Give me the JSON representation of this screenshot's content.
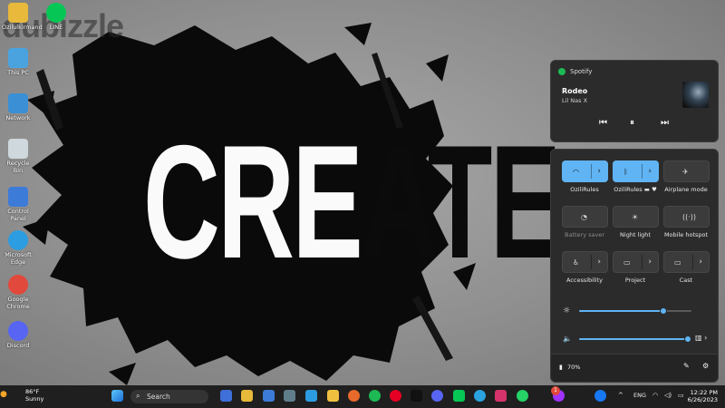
{
  "watermark": "dubizzle",
  "wallpaper_text": {
    "white": "CRE",
    "black": "ATE"
  },
  "desktop_icons": [
    {
      "label": "Ozilulkirmand",
      "icon": "folder-icon",
      "color": "#e8b93a"
    },
    {
      "label": "LINE",
      "icon": "line-app-icon",
      "color": "#06c755"
    },
    {
      "label": "This PC",
      "icon": "monitor-icon",
      "color": "#4aa3df"
    },
    {
      "label": "Network",
      "icon": "network-icon",
      "color": "#3b8fd4"
    },
    {
      "label": "Recycle Bin",
      "icon": "recycle-bin-icon",
      "color": "#cfd8dc"
    },
    {
      "label": "Control Panel",
      "icon": "control-panel-icon",
      "color": "#3d7bd8"
    },
    {
      "label": "Microsoft Edge",
      "icon": "edge-icon",
      "color": "#2b9de0"
    },
    {
      "label": "Google Chrome",
      "icon": "chrome-icon",
      "color": "#e0493b"
    },
    {
      "label": "Discord",
      "icon": "discord-icon",
      "color": "#5865f2"
    }
  ],
  "spotify": {
    "app": "Spotify",
    "track": "Rodeo",
    "artist": "Lil Nas X",
    "prev": "⏮",
    "pause": "⏸",
    "next": "⏭"
  },
  "quick_settings": {
    "tiles": [
      {
        "label": "OziliRules",
        "icon": "wifi-icon",
        "glyph": "◠",
        "on": true,
        "split": true
      },
      {
        "label": "OziliRules ▬ ♥",
        "icon": "bluetooth-icon",
        "glyph": "ᛒ",
        "on": true,
        "split": true
      },
      {
        "label": "Airplane mode",
        "icon": "airplane-icon",
        "glyph": "✈",
        "on": false,
        "split": false
      },
      {
        "label": "Battery saver",
        "icon": "battery-saver-icon",
        "glyph": "◔",
        "on": false,
        "split": false,
        "dim": true
      },
      {
        "label": "Night light",
        "icon": "night-light-icon",
        "glyph": "☀",
        "on": false,
        "split": false
      },
      {
        "label": "Mobile hotspot",
        "icon": "hotspot-icon",
        "glyph": "((·))",
        "on": false,
        "split": false
      },
      {
        "label": "Accessibility",
        "icon": "accessibility-icon",
        "glyph": "♿",
        "on": false,
        "split": true
      },
      {
        "label": "Project",
        "icon": "project-icon",
        "glyph": "▭",
        "on": false,
        "split": true
      },
      {
        "label": "Cast",
        "icon": "cast-icon",
        "glyph": "▭",
        "on": false,
        "split": true
      }
    ],
    "chevron": "›",
    "brightness": 0.75,
    "volume": 0.98,
    "battery": "70%"
  },
  "taskbar": {
    "weather_temp": "86°F",
    "weather_desc": "Sunny",
    "search": "Search",
    "language": "ENG",
    "time": "12:22 PM",
    "date": "6/26/2023",
    "badge": "1"
  },
  "colors": {
    "accent": "#61b4f3",
    "panel": "#2b2b2b",
    "spotify": "#1db954"
  }
}
